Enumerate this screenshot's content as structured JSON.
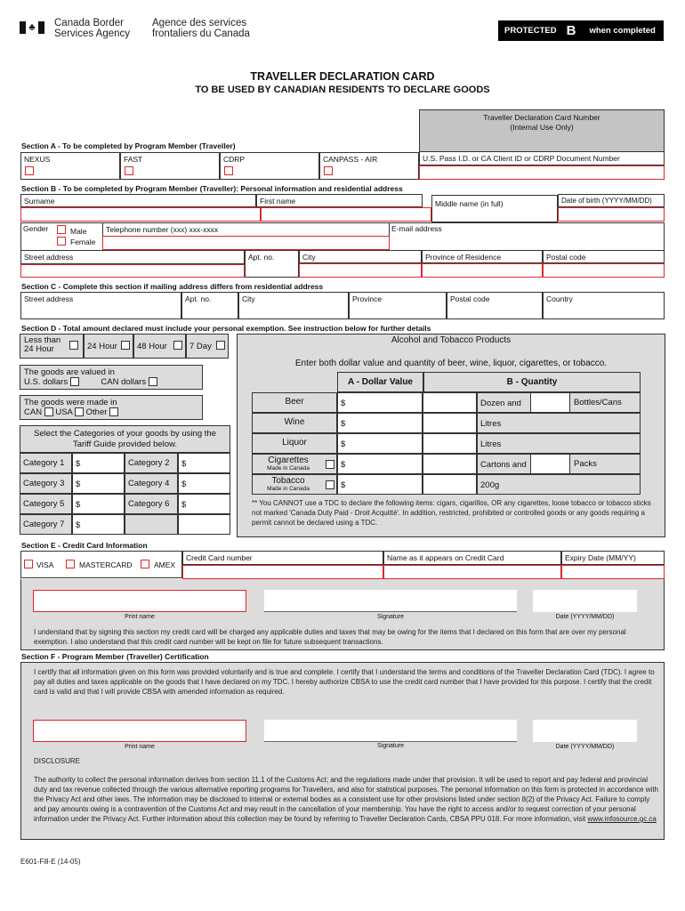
{
  "header": {
    "agency_en_line1": "Canada Border",
    "agency_en_line2": "Services Agency",
    "agency_fr_line1": "Agence des services",
    "agency_fr_line2": "frontaliers du Canada",
    "logo_icon": "canada-flag-icon",
    "protected_label": "PROTECTED",
    "protected_level": "B",
    "protected_suffix": "when completed"
  },
  "title": {
    "main": "TRAVELLER DECLARATION CARD",
    "subtitle": "TO BE USED BY CANADIAN RESIDENTS TO DECLARE GOODS"
  },
  "card_number": {
    "line1": "Traveller Declaration Card Number",
    "line2": "(Internal Use Only)"
  },
  "section_a": {
    "heading": "Section A - To be completed by Program Member (Traveller)",
    "programs": [
      "NEXUS",
      "FAST",
      "CDRP",
      "CANPASS - AIR"
    ],
    "id_label": "U.S. Pass I.D. or CA Client ID or CDRP Document Number",
    "id_value": ""
  },
  "section_b": {
    "heading": "Section B - To be completed by Program Member (Traveller): Personal information and residential address",
    "surname": "Surname",
    "first_name": "First name",
    "middle_name": "Middle name (in full)",
    "dob": "Date of birth (YYYY/MM/DD)",
    "gender": "Gender",
    "male": "Male",
    "female": "Female",
    "telephone": "Telephone number (xxx) xxx-xxxx",
    "email": "E-mail address",
    "street": "Street address",
    "apt": "Apt. no.",
    "city": "City",
    "province": "Province of Residence",
    "postal": "Postal code"
  },
  "section_c": {
    "heading": "Section C - Complete this section if mailing address differs from residential address",
    "street": "Street address",
    "apt": "Apt. no.",
    "city": "City",
    "province": "Province",
    "postal": "Postal code",
    "country": "Country"
  },
  "section_d": {
    "heading": "Section D - Total amount declared must include your personal exemption. See instruction below for further details",
    "durations": {
      "less_than_line1": "Less than",
      "less_than_line2": "24 Hour",
      "h24": "24 Hour",
      "h48": "48 Hour",
      "d7": "7 Day"
    },
    "valued_in": "The goods are valued in",
    "usd": "U.S. dollars",
    "cad": "CAN dollars",
    "made_in": "The goods were made in",
    "can": "CAN",
    "usa": "USA",
    "other": "Other",
    "categories_intro_line1": "Select the Categories of your goods by using the",
    "categories_intro_line2": "Tariff Guide provided below.",
    "categories": [
      "Category 1",
      "Category 2",
      "Category 3",
      "Category 4",
      "Category 5",
      "Category 6",
      "Category 7"
    ],
    "dollar": "$",
    "alcohol": {
      "title": "Alcohol and Tobacco Products",
      "instruction": "Enter both dollar value and quantity of beer, wine, liquor, cigarettes, or tobacco.",
      "col_a": "A - Dollar Value",
      "col_b": "B - Quantity",
      "rows": [
        {
          "item": "Beer",
          "sub": "",
          "q1": "Dozen and",
          "q2": "Bottles/Cans"
        },
        {
          "item": "Wine",
          "sub": "",
          "q1": "Litres",
          "q2": ""
        },
        {
          "item": "Liquor",
          "sub": "",
          "q1": "Litres",
          "q2": ""
        },
        {
          "item": "Cigarettes",
          "sub": "Made in Canada",
          "q1": "Cartons and",
          "q2": "Packs"
        },
        {
          "item": "Tobacco",
          "sub": "Made in Canada",
          "q1": "200g",
          "q2": ""
        }
      ],
      "note": "** You CANNOT use a TDC to declare the following items: cigars, cigarillos, OR any cigarettes, loose tobacco or tobacco sticks not marked 'Canada Duty Paid - Droit Acquitté'. In addition, restricted, prohibited or controlled goods or any goods requiring a permit cannot be declared using a TDC."
    }
  },
  "section_e": {
    "heading": "Section E - Credit Card Information",
    "visa": "VISA",
    "mastercard": "MASTERCARD",
    "amex": "AMEX",
    "card_number": "Credit Card number",
    "name_on_card": "Name as it appears on Credit Card",
    "expiry": "Expiry Date (MM/YY)",
    "print_name": "Print name",
    "signature": "Signature",
    "date": "Date (YYYY/MM/DD)",
    "statement": "I understand that by signing this section my credit card will be charged any applicable duties and taxes that may be owing for the items that I declared on this form that are over my personal exemption. I also understand that this credit card number will be kept on file for future subsequent transactions."
  },
  "section_f": {
    "heading": "Section F - Program Member (Traveller) Certification",
    "statement": "I certify that all information given on this form was provided voluntarily and is true and complete.  I certify that I understand the terms and conditions of the Traveller Declaration Card (TDC).  I agree to pay all duties and taxes applicable on the goods that I have declared on my TDC.  I hereby authorize CBSA to use the credit card number that I have provided for this purpose.  I certify that the credit card is valid and that I will provide CBSA with amended information as required.",
    "print_name": "Print name",
    "signature": "Signature",
    "date": "Date (YYYY/MM/DD)",
    "disclosure_title": "DISCLOSURE",
    "disclosure_text": "The authority to collect the personal information derives from section 11.1 of the Customs Act; and the regulations made under that provision. It will be used to report and pay federal and provincial duty and tax revenue collected through the various alternative reporting programs for Travellers, and also for statistical purposes. The personal information on this form is protected in accordance with the Privacy Act and other laws. The information may be disclosed to internal or external bodies as a consistent use for other provisions listed under section 8(2) of the Privacy Act. Failure to comply and pay amounts owing is a contravention of the Customs Act and may result in the cancellation of your membership. You have the right to access and/or to request correction of your personal information under the Privacy Act. Further information about this collection may be found by referring to Traveller Declaration Cards, CBSA PPU 018. For more information, visit ",
    "link": "www.infosource.gc.ca"
  },
  "footer": {
    "form_code": "E601-Fill-E (14-05)"
  }
}
